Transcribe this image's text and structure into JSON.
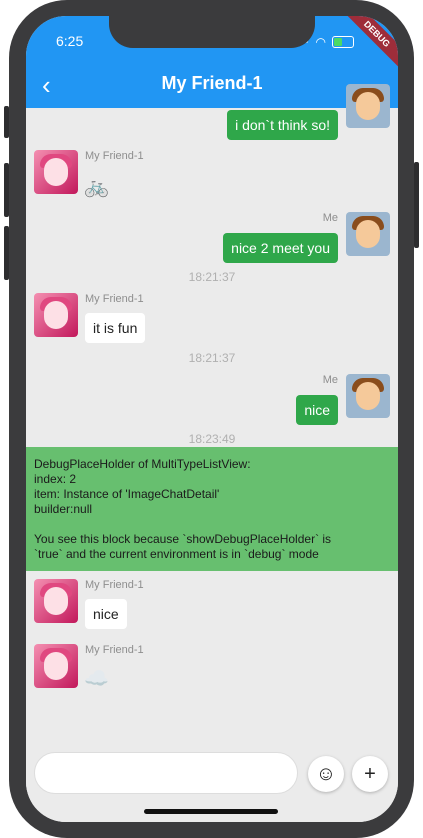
{
  "status": {
    "time": "6:25",
    "debug_banner": "DEBUG"
  },
  "appbar": {
    "back": "‹",
    "title": "My Friend-1"
  },
  "messages": {
    "m0": {
      "text": "i don`t think so!"
    },
    "m1": {
      "name": "My Friend-1",
      "emoji": "🚲"
    },
    "m2": {
      "name": "Me",
      "text": "nice 2 meet you"
    },
    "t1": "18:21:37",
    "m3": {
      "name": "My Friend-1",
      "text": "it is fun"
    },
    "t2": "18:21:37",
    "m4": {
      "name": "Me",
      "text": "nice"
    },
    "t3": "18:23:49",
    "debug": "DebugPlaceHolder of MultiTypeListView:\nindex: 2\nitem: Instance of 'ImageChatDetail'\nbuilder:null\n\nYou see this block because `showDebugPlaceHolder` is\n`true` and the current environment is in `debug` mode",
    "m5": {
      "name": "My Friend-1",
      "text": "nice"
    },
    "m6": {
      "name": "My Friend-1",
      "emoji": "☁️"
    }
  },
  "input": {
    "placeholder": ""
  },
  "buttons": {
    "emoji": "☺",
    "add": "+"
  },
  "colors": {
    "appbar": "#2196f3",
    "my_bubble": "#2fa74a",
    "debug_block": "#67bf6f"
  }
}
